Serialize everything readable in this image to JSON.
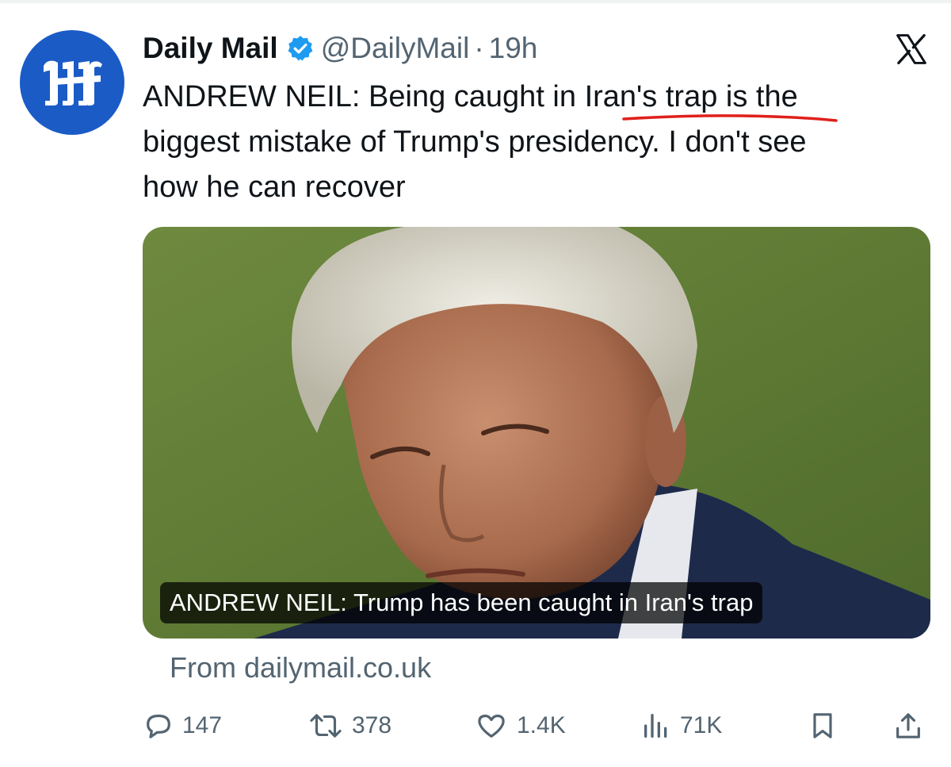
{
  "tweet": {
    "author": {
      "display_name": "Daily Mail",
      "handle": "@DailyMail",
      "separator": "·",
      "time": "19h",
      "verified": true,
      "avatar_icon": "daily-mail-logo-icon"
    },
    "text_lines": [
      "ANDREW NEIL: Being caught in Iran's trap is the",
      "biggest mistake of Trump's presidency. I don't see",
      "how he can recover"
    ],
    "media": {
      "caption": "ANDREW NEIL: Trump has been caught in Iran's trap"
    },
    "source": "From dailymail.co.uk",
    "actions": {
      "replies": "147",
      "reposts": "378",
      "likes": "1.4K",
      "views": "71K"
    }
  },
  "colors": {
    "text": "#0f1419",
    "secondary": "#536471",
    "verified": "#1d9bf0",
    "avatar": "#1b5bc6",
    "underline_annotation": "#e0201c"
  },
  "icons": {
    "platform": "x-logo-icon",
    "reply": "reply-icon",
    "repost": "repost-icon",
    "like": "heart-icon",
    "views": "views-icon",
    "bookmark": "bookmark-icon",
    "share": "share-icon"
  }
}
